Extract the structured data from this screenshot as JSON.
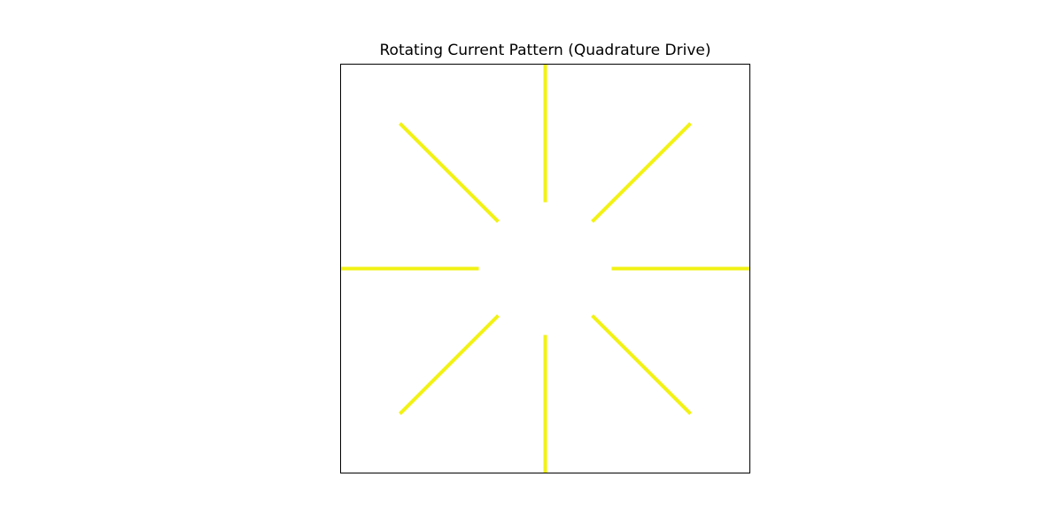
{
  "title": "Rotating Current Pattern (Quadrature Drive)",
  "colors": {
    "spoke": "#f2f214",
    "frame": "#000000",
    "background": "#ffffff"
  },
  "spokes": [
    {
      "name": "spoke-north",
      "angle_deg": 90
    },
    {
      "name": "spoke-northeast",
      "angle_deg": 45
    },
    {
      "name": "spoke-east",
      "angle_deg": 0
    },
    {
      "name": "spoke-southeast",
      "angle_deg": -45
    },
    {
      "name": "spoke-south",
      "angle_deg": -90
    },
    {
      "name": "spoke-southwest",
      "angle_deg": -135
    },
    {
      "name": "spoke-west",
      "angle_deg": 180
    },
    {
      "name": "spoke-northwest",
      "angle_deg": 135
    }
  ]
}
